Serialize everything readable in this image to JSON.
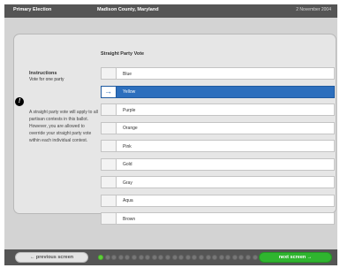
{
  "header": {
    "election": "Primary Election",
    "county": "Madison County, Maryland",
    "date": "2 November 2004"
  },
  "contest": {
    "title": "Straight Party Vote",
    "instructions_title": "Instructions",
    "instructions_sub": "Vote for one party",
    "note": "A straight party vote will apply to all partisan contests in this ballot. However, you are allowed to override your straight party vote within each individual contest.",
    "choices": [
      {
        "label": "Blue",
        "selected": false
      },
      {
        "label": "Yellow",
        "selected": true
      },
      {
        "label": "Purple",
        "selected": false
      },
      {
        "label": "Orange",
        "selected": false
      },
      {
        "label": "Pink",
        "selected": false
      },
      {
        "label": "Gold",
        "selected": false
      },
      {
        "label": "Gray",
        "selected": false
      },
      {
        "label": "Aqua",
        "selected": false
      },
      {
        "label": "Brown",
        "selected": false
      }
    ]
  },
  "footer": {
    "prev_label": "← previous screen",
    "next_label": "next screen →",
    "progress_completed": 1,
    "progress_total": 27
  },
  "colors": {
    "selected": "#2d6fbd",
    "next_button": "#2fb52f",
    "progress_done": "#5fce3c"
  },
  "icons": {
    "warning": "exclamation-icon",
    "selection": "arrow-right-icon"
  }
}
